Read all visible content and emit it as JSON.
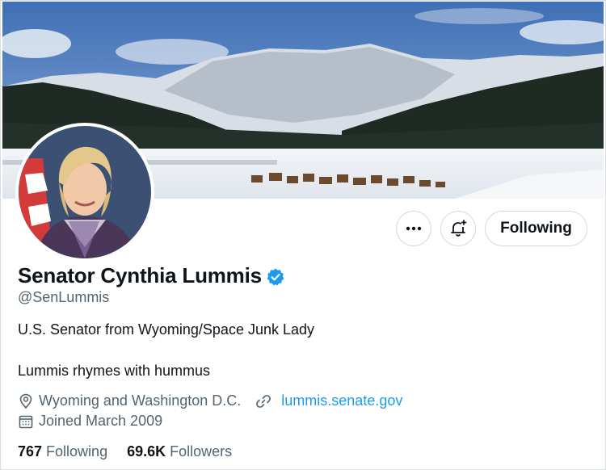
{
  "profile": {
    "display_name": "Senator Cynthia Lummis",
    "handle": "@SenLummis",
    "bio_line1": "U.S. Senator from Wyoming/Space Junk Lady",
    "bio_line2": "Lummis rhymes with hummus",
    "location": "Wyoming and Washington D.C.",
    "website": "lummis.senate.gov",
    "joined": "Joined March 2009"
  },
  "stats": {
    "following_count": "767",
    "following_label": "Following",
    "followers_count": "69.6K",
    "followers_label": "Followers"
  },
  "actions": {
    "follow_label": "Following"
  },
  "colors": {
    "accent": "#1d9bf0",
    "secondary_text": "#536471",
    "primary_text": "#0f1419",
    "border": "#cfd9de"
  },
  "icons": [
    "more-icon",
    "bell-plus-icon",
    "verified-badge-icon",
    "location-pin-icon",
    "link-icon",
    "calendar-icon"
  ]
}
